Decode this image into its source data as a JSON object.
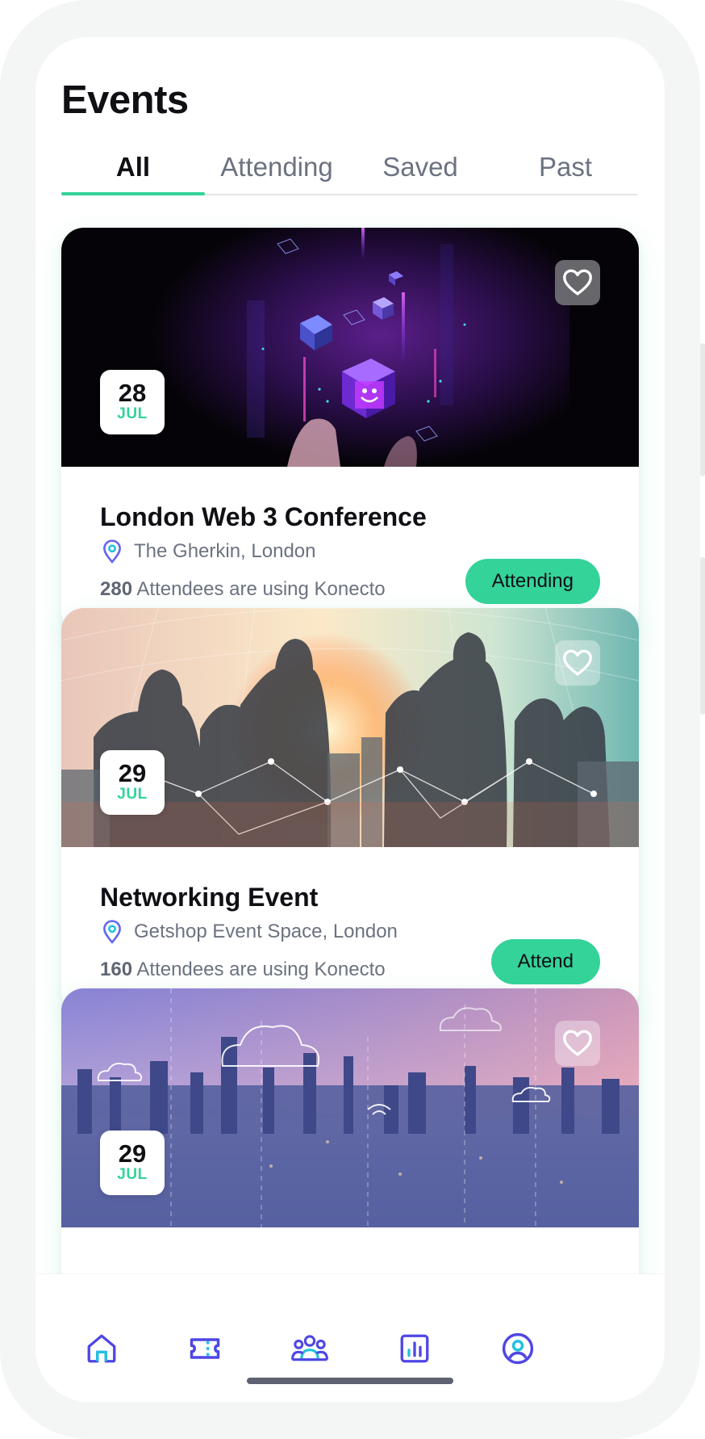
{
  "header": {
    "title": "Events"
  },
  "tabs": [
    {
      "label": "All",
      "active": true
    },
    {
      "label": "Attending",
      "active": false
    },
    {
      "label": "Saved",
      "active": false
    },
    {
      "label": "Past",
      "active": false
    }
  ],
  "events": [
    {
      "title": "London Web 3 Conference",
      "location": "The Gherkin, London",
      "attendee_count": "280",
      "attendee_text": "Attendees are using Konecto",
      "date_day": "28",
      "date_month": "JUL",
      "action_label": "Attending",
      "image_icon": "web3-cubes-image"
    },
    {
      "title": "Networking Event",
      "location": "Getshop Event Space, London",
      "attendee_count": "160",
      "attendee_text": "Attendees are using Konecto",
      "date_day": "29",
      "date_month": "JUL",
      "action_label": "Attend",
      "image_icon": "business-silhouettes-image"
    },
    {
      "date_day": "29",
      "date_month": "JUL",
      "image_icon": "city-skyline-image"
    }
  ],
  "bottom_nav": [
    {
      "icon": "home-icon"
    },
    {
      "icon": "ticket-icon"
    },
    {
      "icon": "people-icon"
    },
    {
      "icon": "chart-icon"
    },
    {
      "icon": "profile-icon"
    }
  ],
  "colors": {
    "accent": "#34d399",
    "nav_icon": "#4f46e5",
    "text_primary": "#0f0f14",
    "text_secondary": "#6b7280"
  }
}
